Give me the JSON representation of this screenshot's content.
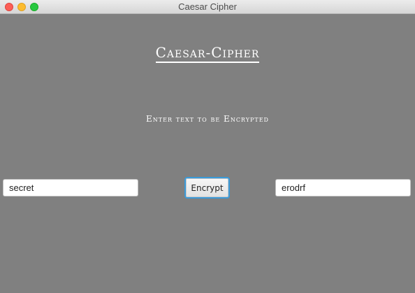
{
  "window": {
    "title": "Caesar Cipher"
  },
  "main": {
    "heading": "Caesar-Cipher",
    "prompt": "Enter text to be Encrypted",
    "input_value": "secret",
    "encrypt_label": "Encrypt",
    "output_value": "erodrf"
  },
  "colors": {
    "background": "#808080",
    "accent": "#3a9ad9"
  }
}
